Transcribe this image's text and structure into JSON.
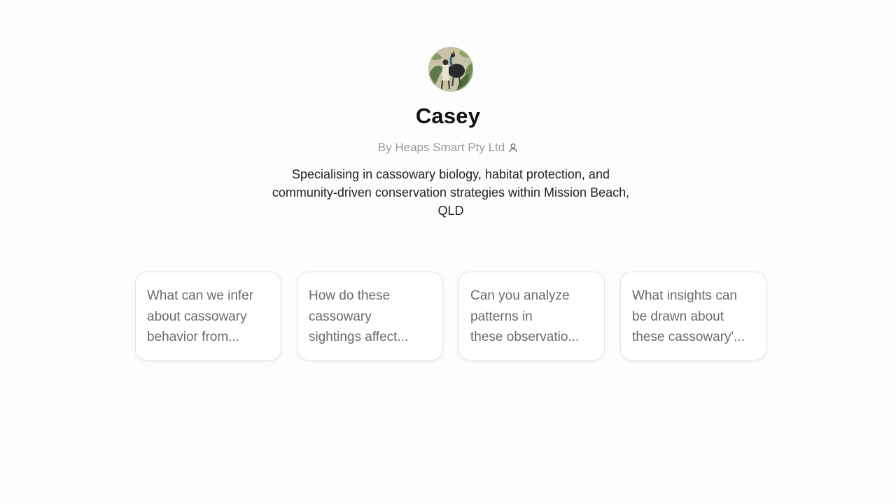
{
  "profile": {
    "name": "Casey",
    "byline": "By Heaps Smart Pty Ltd",
    "description_lines": [
      "Specialising in cassowary biology, habitat protection, and",
      "community-driven conservation strategies within Mission Beach,",
      "QLD"
    ]
  },
  "suggestions": [
    {
      "lines": [
        "What can we infer",
        "about cassowary",
        "behavior from..."
      ]
    },
    {
      "lines": [
        "How do these",
        "cassowary",
        "sightings affect..."
      ]
    },
    {
      "lines": [
        "Can you analyze",
        "patterns in",
        "these observatio..."
      ]
    },
    {
      "lines": [
        "What insights can",
        "be drawn about",
        "these cassowary'..."
      ]
    }
  ],
  "icons": {
    "avatar": "cassowary-illustration-avatar",
    "byline_icon": "person-icon"
  }
}
